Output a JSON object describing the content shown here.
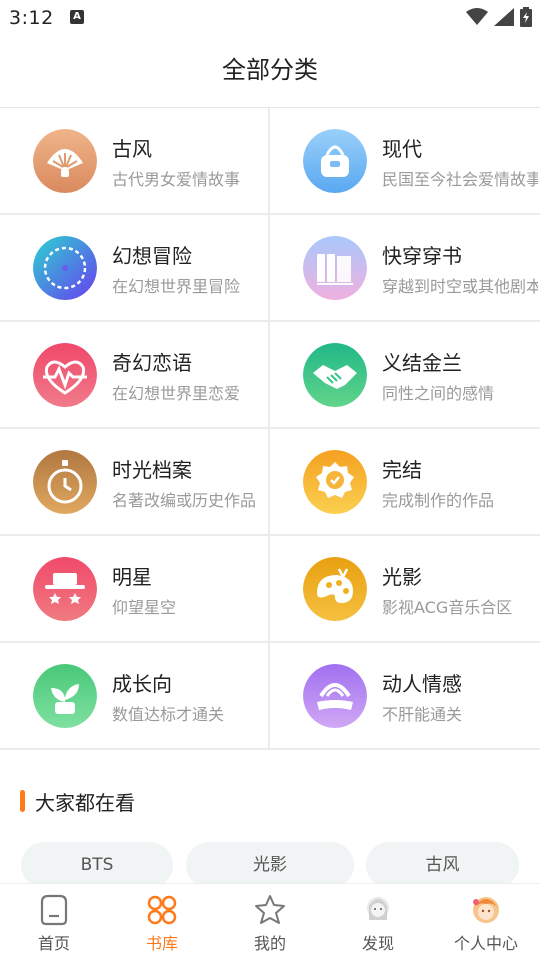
{
  "status_bar": {
    "time": "3:12",
    "notification_glyph": "A"
  },
  "page": {
    "title": "全部分类"
  },
  "categories": [
    {
      "name": "古风",
      "desc": "古代男女爱情故事",
      "icon": "fan-icon",
      "color": "#e8a07a"
    },
    {
      "name": "现代",
      "desc": "民国至今社会爱情故事",
      "icon": "handbag-icon",
      "color": "#7dbdf5"
    },
    {
      "name": "幻想冒险",
      "desc": "在幻想世界里冒险",
      "icon": "compass-icon",
      "color": "#6a5cf0"
    },
    {
      "name": "快穿穿书",
      "desc": "穿越到时空或其他剧本",
      "icon": "books-icon",
      "color": "#c9a6f0"
    },
    {
      "name": "奇幻恋语",
      "desc": "在幻想世界里恋爱",
      "icon": "heartbeat-icon",
      "color": "#f0506a"
    },
    {
      "name": "义结金兰",
      "desc": "同性之间的感情",
      "icon": "handshake-icon",
      "color": "#35c48a"
    },
    {
      "name": "时光档案",
      "desc": "名著改编或历史作品",
      "icon": "stopwatch-icon",
      "color": "#c98a4a"
    },
    {
      "name": "完结",
      "desc": "完成制作的作品",
      "icon": "badge-check-icon",
      "color": "#f5b53a"
    },
    {
      "name": "明星",
      "desc": "仰望星空",
      "icon": "star-hat-icon",
      "color": "#f0607a"
    },
    {
      "name": "光影",
      "desc": "影视ACG音乐合区",
      "icon": "palette-icon",
      "color": "#f0b020"
    },
    {
      "name": "成长向",
      "desc": "数值达标才通关",
      "icon": "sprout-icon",
      "color": "#62d48a"
    },
    {
      "name": "动人情感",
      "desc": "不肝能通关",
      "icon": "book-rainbow-icon",
      "color": "#b78af0"
    }
  ],
  "trending": {
    "title": "大家都在看",
    "tags": [
      "BTS",
      "光影",
      "古风"
    ]
  },
  "bottom_nav": {
    "active_color": "#ff7a1a",
    "items": [
      {
        "label": "首页",
        "icon": "home-icon"
      },
      {
        "label": "书库",
        "icon": "library-grid-icon"
      },
      {
        "label": "我的",
        "icon": "star-icon"
      },
      {
        "label": "发现",
        "icon": "discover-avatar-icon"
      },
      {
        "label": "个人中心",
        "icon": "profile-avatar-icon"
      }
    ]
  }
}
